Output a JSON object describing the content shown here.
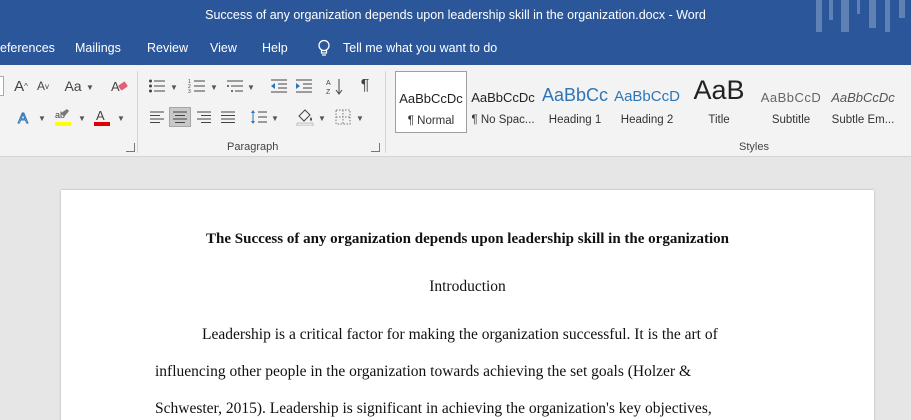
{
  "titlebar": {
    "title": "Success of any organization depends upon leadership skill in the organization.docx  -  Word"
  },
  "menu": {
    "references": "eferences",
    "mailings": "Mailings",
    "review": "Review",
    "view": "View",
    "help": "Help",
    "tell_me": "Tell me what you want to do"
  },
  "ribbon": {
    "paragraph_label": "Paragraph",
    "styles_label": "Styles",
    "font": {
      "change_case": "Aa",
      "grow": "A",
      "shrink": "A"
    }
  },
  "styles": [
    {
      "sample": "AaBbCcDc",
      "name": "¶ Normal"
    },
    {
      "sample": "AaBbCcDc",
      "name": "¶ No Spac..."
    },
    {
      "sample": "AaBbCc",
      "name": "Heading 1"
    },
    {
      "sample": "AaBbCcD",
      "name": "Heading 2"
    },
    {
      "sample": "AaB",
      "name": "Title"
    },
    {
      "sample": "AaBbCcD",
      "name": "Subtitle"
    },
    {
      "sample": "AaBbCcDc",
      "name": "Subtle Em..."
    }
  ],
  "document": {
    "heading": "The Success of any organization depends upon leadership skill in the organization",
    "intro": "Introduction",
    "lines": [
      "Leadership is a critical factor for making the organization successful. It is the art of",
      "influencing other people in the organization towards achieving the set goals (Holzer &",
      "Schwester, 2015). Leadership is significant in achieving the organization's key objectives,"
    ]
  }
}
